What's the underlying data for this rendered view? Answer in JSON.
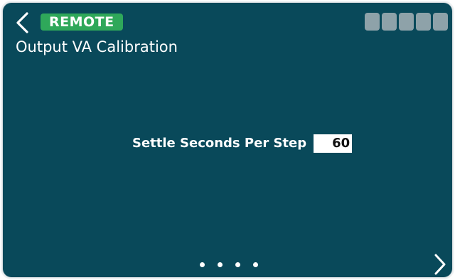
{
  "header": {
    "back_icon": "chevron-left-icon",
    "remote_badge": "REMOTE",
    "status_block_count": 5
  },
  "page": {
    "title": "Output VA Calibration"
  },
  "setting": {
    "label": "Settle Seconds Per Step",
    "value": "60"
  },
  "pagination": {
    "page_count": 4,
    "next_icon": "chevron-right-icon"
  },
  "colors": {
    "background": "#09495a",
    "badge": "#2fa85a",
    "status_block": "#8ea2a9",
    "text": "#ffffff"
  }
}
